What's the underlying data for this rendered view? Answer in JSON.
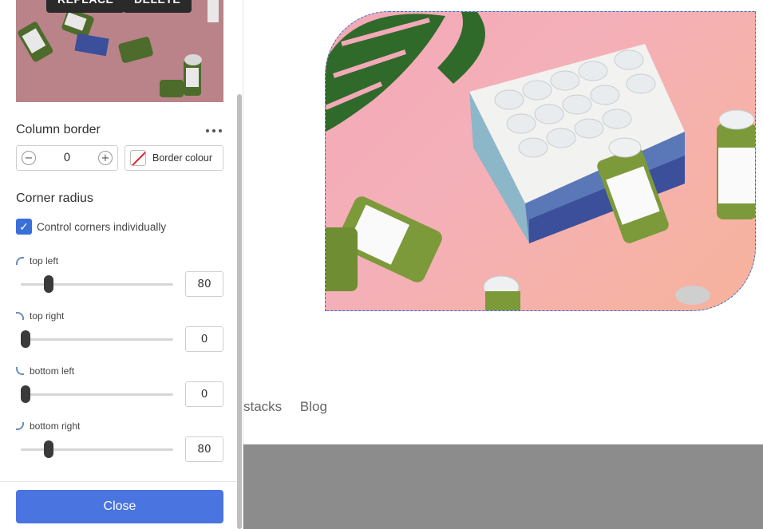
{
  "thumbnail": {
    "replace_label": "REPLACE",
    "delete_label": "DELETE"
  },
  "column_border": {
    "title": "Column border",
    "more_icon": "more-dots-icon",
    "width_value": "0",
    "decrement_symbol": "−",
    "increment_symbol": "+",
    "border_colour_label": "Border colour"
  },
  "corner_radius": {
    "title": "Corner radius",
    "individual_label": "Control corners individually",
    "individual_checked": true,
    "check_symbol": "✓",
    "corners": [
      {
        "label": "top left",
        "value": "80",
        "level": 0.16
      },
      {
        "label": "top right",
        "value": "0",
        "level": 0
      },
      {
        "label": "bottom left",
        "value": "0",
        "level": 0
      },
      {
        "label": "bottom right",
        "value": "80",
        "level": 0.16
      }
    ]
  },
  "footer": {
    "close_label": "Close"
  },
  "page": {
    "nav_links": [
      "stacks",
      "Blog"
    ]
  },
  "colors": {
    "accent": "#4a74e0",
    "selection_border": "#2f6fd1",
    "checkbox": "#3b6fd8",
    "gray_band": "#8c8c8c"
  }
}
